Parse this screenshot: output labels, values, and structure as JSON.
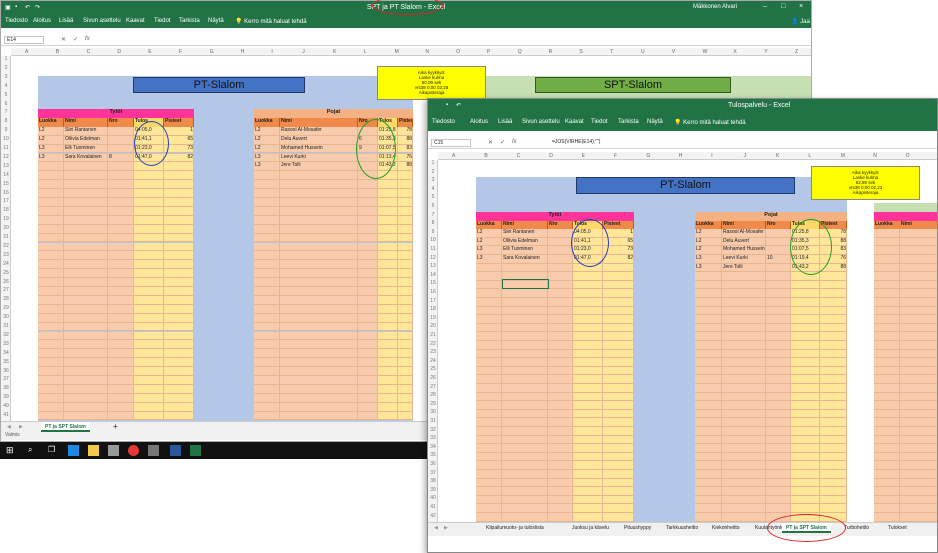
{
  "win1": {
    "title": "SPT ja PT Slalom - Excel",
    "user": "Mäkkonen Alvari",
    "share": "Jaa",
    "ribbon": [
      "Tiedosto",
      "Aloitus",
      "Lisää",
      "Sivun asettelu",
      "Kaavat",
      "Tiedot",
      "Tarkista",
      "Näytä",
      "Kerro mitä haluat tehdä"
    ],
    "name_box": "E14",
    "columns": [
      "A",
      "B",
      "C",
      "D",
      "E",
      "F",
      "G",
      "H",
      "I",
      "J",
      "K",
      "L",
      "M",
      "N",
      "O",
      "P",
      "Q",
      "R",
      "S",
      "T",
      "U",
      "V",
      "W",
      "X",
      "Y",
      "Z"
    ],
    "rows": [
      "1",
      "2",
      "3",
      "4",
      "5",
      "6",
      "7",
      "8",
      "9",
      "10",
      "11",
      "12",
      "13",
      "14",
      "15",
      "16",
      "17",
      "18",
      "19",
      "20",
      "21",
      "22",
      "23",
      "24",
      "25",
      "26",
      "27",
      "28",
      "29",
      "30",
      "31",
      "32",
      "33",
      "34",
      "35",
      "36",
      "37",
      "38",
      "39",
      "40",
      "41"
    ],
    "banner_pt": "PT-Slalom",
    "banner_spt": "SPT-Slalom",
    "yellow_lines": [
      "Aika kyykkyä:",
      "Laske kulma",
      "50,09 sek",
      "vrs38 0:00 02,28",
      "Aikapisteraja"
    ],
    "girls": {
      "title": "Tytöt",
      "headers": [
        "Luokka",
        "Nimi",
        "Nro",
        "Tulos",
        "Pisteet"
      ],
      "rows": [
        [
          "L2",
          "Siiri Rantanen",
          "",
          "04:05,0",
          "1"
        ],
        [
          "L2",
          "Oliivia Edelman",
          "",
          "01:41,1",
          "65"
        ],
        [
          "L3",
          "Elli Tuominen",
          "",
          "01:23,0",
          "73"
        ],
        [
          "L3",
          "Sara Kovalainen",
          "8",
          "01:47,0",
          "82"
        ]
      ]
    },
    "boys": {
      "title": "Pojat",
      "headers": [
        "Luokka",
        "Nimi",
        "Nro",
        "Tulos",
        "Pisteet"
      ],
      "rows": [
        [
          "L2",
          "Rasool Al-Mosafer",
          "",
          "01:25,8",
          "78"
        ],
        [
          "L2",
          "Delu Auvert",
          "6",
          "01:35,3",
          "88"
        ],
        [
          "L2",
          "Mohamed Hussein",
          "9",
          "01:07,5",
          "83"
        ],
        [
          "L3",
          "Leevi Kurki",
          "",
          "01:13,4",
          "76"
        ],
        [
          "L3",
          "Jere Tolli",
          "",
          "01:43,2",
          "88"
        ]
      ]
    },
    "sheet_tabs": [
      "PT ja SPT Slalom"
    ],
    "add_sheet": "+",
    "status": "Valmis"
  },
  "win2": {
    "title": "Tulospalvelu - Excel",
    "ribbon": [
      "Tiedosto",
      "Aloitus",
      "Lisää",
      "Sivun asettelu",
      "Kaavat",
      "Tiedot",
      "Tarkista",
      "Näytä",
      "Kerro mitä haluat tehdä"
    ],
    "name_box": "C15",
    "formula": "=JOS(VIRHE(E14);\"\")",
    "columns": [
      "A",
      "B",
      "C",
      "D",
      "E",
      "F",
      "G",
      "H",
      "I",
      "J",
      "K",
      "L",
      "M",
      "N",
      "O",
      "P"
    ],
    "rows": [
      "1",
      "2",
      "3",
      "4",
      "5",
      "6",
      "7",
      "8",
      "9",
      "10",
      "11",
      "12",
      "13",
      "14",
      "15",
      "16",
      "17",
      "18",
      "19",
      "20",
      "21",
      "22",
      "23",
      "24",
      "25",
      "26",
      "27",
      "28",
      "29",
      "30",
      "31",
      "32",
      "33",
      "34",
      "35",
      "36",
      "37",
      "38",
      "39",
      "40",
      "41",
      "42"
    ],
    "banner_pt": "PT-Slalom",
    "yellow_lines": [
      "Aika kyykkyä:",
      "Laske kulma",
      "52,89 sek",
      "vrs38 0:00 02,23",
      "Aikapisteraja"
    ],
    "girls": {
      "title": "Tytöt",
      "headers": [
        "Luokka",
        "Nimi",
        "Nro",
        "Tulos",
        "Pisteet"
      ],
      "rows": [
        [
          "L2",
          "Siiri Rantanen",
          "",
          "04:05,0",
          "1"
        ],
        [
          "L2",
          "Oliivia Edelman",
          "",
          "01:41,1",
          "65"
        ],
        [
          "L3",
          "Elli Tuominen",
          "",
          "01:23,0",
          "73"
        ],
        [
          "L3",
          "Sara Kovalainen",
          "",
          "01:47,0",
          "82"
        ]
      ]
    },
    "boys": {
      "title": "Pojat",
      "headers": [
        "Luokka",
        "Nimi",
        "Nro",
        "Tulos",
        "Pisteet"
      ],
      "rows": [
        [
          "L2",
          "Rasool Al-Mosafer",
          "",
          "01:25,8",
          "78"
        ],
        [
          "L2",
          "Delu Auvert",
          "",
          "01:35,3",
          "88"
        ],
        [
          "L2",
          "Mohamed Hussein",
          "",
          "01:07,5",
          "83"
        ],
        [
          "L3",
          "Leevi Kurki",
          "10",
          "01:19,4",
          "76"
        ],
        [
          "L3",
          "Jere Tolli",
          "",
          "01:43,2",
          "88"
        ]
      ]
    },
    "extra_headers": [
      "Luokka",
      "Nimi"
    ],
    "sheet_tabs": [
      "Kilpailumuoto- ja tuloslista",
      "Juoksu ja kävelu",
      "Pituushyppy",
      "Tarkkuusheitto",
      "Kiekonheitto",
      "Kuulantyöntö",
      "PT ja SPT Slalom",
      "Turboheitto",
      "Tulokset"
    ],
    "active_tab": "PT ja SPT Slalom"
  },
  "colors": {
    "excel_green": "#217346",
    "banner_blue": "#4472c4",
    "spt_green": "#70ad47",
    "header_pink": "#ff3399",
    "header_orange": "#f4b183",
    "cell_peach": "#f8cbad",
    "result_yellow": "#ffe699",
    "panel_blue": "#b4c7e7",
    "circle_blue": "#1f3fbf",
    "circle_green": "#22a022",
    "circle_red": "#e02020"
  }
}
